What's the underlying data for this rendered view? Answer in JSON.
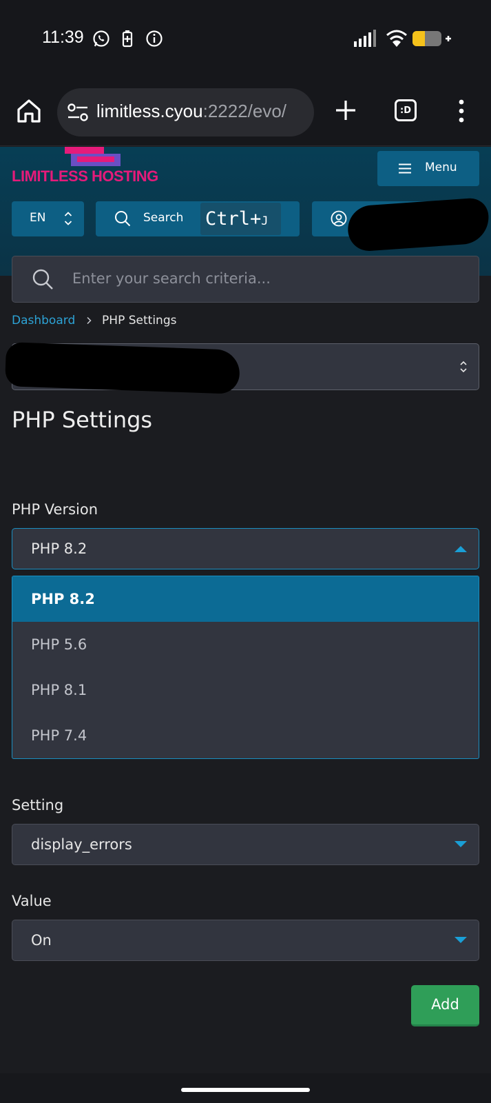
{
  "status_bar": {
    "time": "11:39",
    "icons": [
      "whatsapp-icon",
      "battery-saver-icon",
      "info-icon",
      "signal-icon",
      "wifi-icon",
      "battery-icon"
    ]
  },
  "browser": {
    "url_host": "limitless.cyou",
    "url_rest": ":2222/evo/",
    "tab_count_label": ":D"
  },
  "header": {
    "logo_text": "LIMITLESS HOSTING",
    "menu_label": "Menu",
    "lang_label": "EN",
    "search_label": "Search",
    "shortcut_main": "Ctrl+",
    "shortcut_key": "J"
  },
  "global_search": {
    "placeholder": "Enter your search criteria..."
  },
  "breadcrumb": {
    "root": "Dashboard",
    "current": "PHP Settings"
  },
  "page": {
    "title": "PHP Settings"
  },
  "form": {
    "php_version_label": "PHP Version",
    "php_version_value": "PHP 8.2",
    "php_version_options": [
      "PHP 8.2",
      "PHP 5.6",
      "PHP 8.1",
      "PHP 7.4"
    ],
    "setting_label": "Setting",
    "setting_value": "display_errors",
    "value_label": "Value",
    "value_value": "On",
    "add_label": "Add"
  },
  "colors": {
    "accent": "#0d5f84",
    "selected_option": "#0c6b95",
    "add_button": "#2f9e58",
    "brand_pink": "#e51b7a"
  }
}
